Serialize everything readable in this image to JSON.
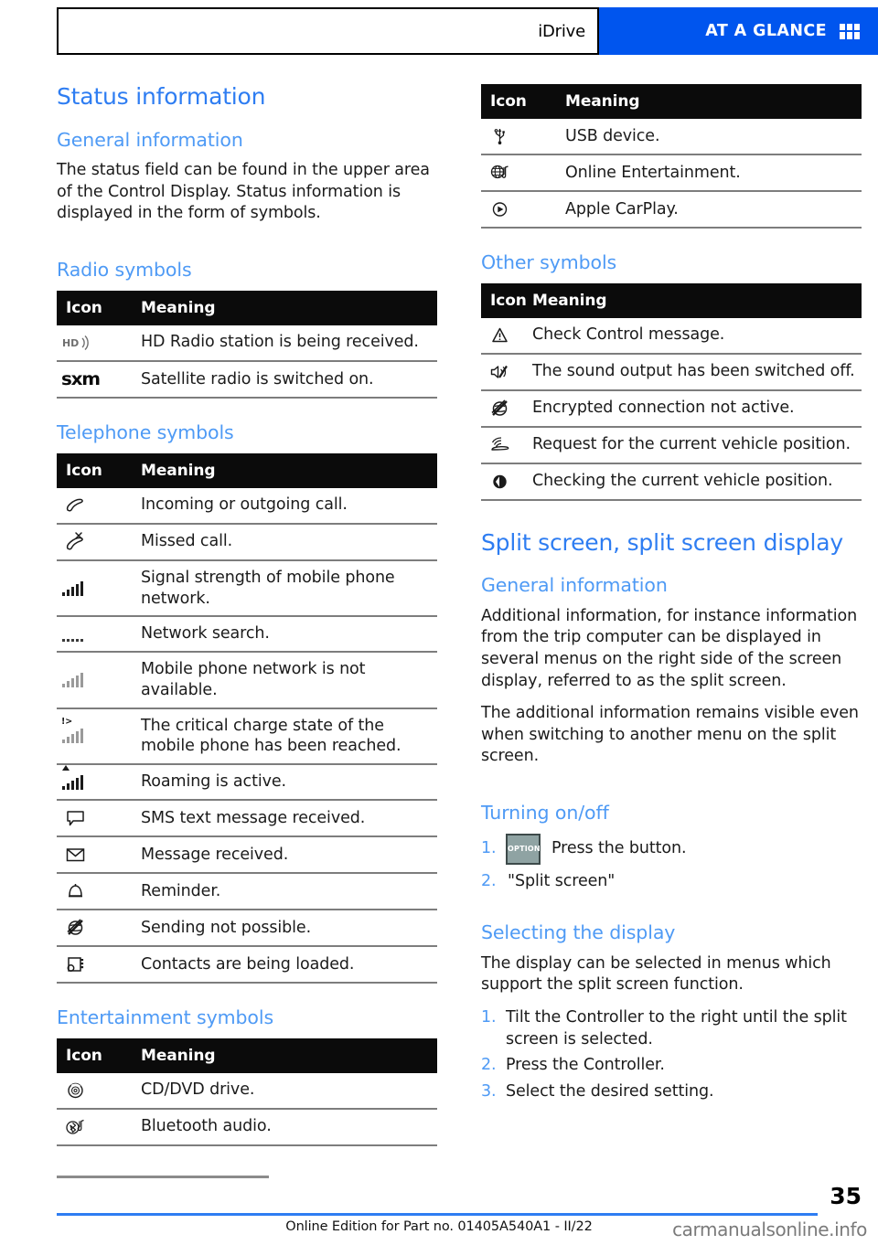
{
  "header": {
    "tab_label": "iDrive",
    "bar_label": "AT A GLANCE",
    "grid_icon": "grid-icon",
    "bar_color": "#0055EE"
  },
  "left_column": {
    "section_title": "Status information",
    "general_information": {
      "heading": "General information",
      "paragraph": "The status field can be found in the upper area of the Control Display. Status information is displayed in the form of symbols."
    },
    "radio_symbols": {
      "heading": "Radio symbols",
      "columns": [
        "Icon",
        "Meaning"
      ],
      "rows": [
        {
          "icon": "hd-radio-icon",
          "meaning": "HD Radio station is being received."
        },
        {
          "icon": "siriusxm-logo-icon",
          "meaning": "Satellite radio is switched on."
        }
      ]
    },
    "telephone_symbols": {
      "heading": "Telephone symbols",
      "columns": [
        "Icon",
        "Meaning"
      ],
      "rows": [
        {
          "icon": "phone-handset-icon",
          "meaning": "Incoming or outgoing call."
        },
        {
          "icon": "missed-call-icon",
          "meaning": "Missed call."
        },
        {
          "icon": "signal-strength-icon",
          "meaning": "Signal strength of mobile phone network."
        },
        {
          "icon": "network-search-icon",
          "meaning": "Network search."
        },
        {
          "icon": "no-network-icon",
          "meaning": "Mobile phone network is not available."
        },
        {
          "icon": "low-battery-signal-icon",
          "meaning": "The critical charge state of the mobile phone has been reached."
        },
        {
          "icon": "roaming-signal-icon",
          "meaning": "Roaming is active."
        },
        {
          "icon": "sms-bubble-icon",
          "meaning": "SMS text message received."
        },
        {
          "icon": "envelope-icon",
          "meaning": "Message received."
        },
        {
          "icon": "bell-icon",
          "meaning": "Reminder."
        },
        {
          "icon": "sending-not-possible-icon",
          "meaning": "Sending not possible."
        },
        {
          "icon": "contacts-loading-icon",
          "meaning": "Contacts are being loaded."
        }
      ]
    },
    "entertainment_symbols": {
      "heading": "Entertainment symbols",
      "columns": [
        "Icon",
        "Meaning"
      ],
      "rows": [
        {
          "icon": "cd-dvd-icon",
          "meaning": "CD/DVD drive."
        },
        {
          "icon": "bluetooth-audio-icon",
          "meaning": "Bluetooth audio."
        }
      ]
    }
  },
  "right_column": {
    "entertainment_symbols_continued": {
      "columns": [
        "Icon",
        "Meaning"
      ],
      "rows": [
        {
          "icon": "usb-icon",
          "meaning": "USB device."
        },
        {
          "icon": "online-entertainment-icon",
          "meaning": "Online Entertainment."
        },
        {
          "icon": "apple-carplay-icon",
          "meaning": "Apple CarPlay."
        }
      ]
    },
    "other_symbols": {
      "heading": "Other symbols",
      "columns": [
        "Icon",
        "Meaning"
      ],
      "rows": [
        {
          "icon": "warning-triangle-icon",
          "meaning": "Check Control message."
        },
        {
          "icon": "mute-speaker-icon",
          "meaning": "The sound output has been switched off."
        },
        {
          "icon": "encryption-off-icon",
          "meaning": "Encrypted connection not active."
        },
        {
          "icon": "vehicle-position-request-icon",
          "meaning": "Request for the current vehicle position."
        },
        {
          "icon": "vehicle-position-checking-icon",
          "meaning": "Checking the current vehicle position."
        }
      ]
    },
    "split_screen": {
      "section_title": "Split screen, split screen display",
      "general_information": {
        "heading": "General information",
        "paragraph_1": "Additional information, for instance information from the trip computer can be displayed in several menus on the right side of the screen display, referred to as the split screen.",
        "paragraph_2": "The additional information remains visible even when switching to another menu on the split screen."
      },
      "turning_on_off": {
        "heading": "Turning on/off",
        "steps": [
          {
            "num": "1.",
            "key_label": "OPTION",
            "text": "Press the button."
          },
          {
            "num": "2.",
            "key_label": "",
            "text": "\"Split screen\""
          }
        ]
      },
      "selecting_the_display": {
        "heading": "Selecting the display",
        "paragraph": "The display can be selected in menus which support the split screen function.",
        "steps": [
          {
            "num": "1.",
            "text": "Tilt the Controller to the right until the split screen is selected."
          },
          {
            "num": "2.",
            "text": "Press the Controller."
          },
          {
            "num": "3.",
            "text": "Select the desired setting."
          }
        ]
      }
    }
  },
  "footer": {
    "page_number": "35",
    "edition_text": "Online Edition for Part no. 01405A540A1 - II/22",
    "watermark": "carmanualsonline.info"
  }
}
